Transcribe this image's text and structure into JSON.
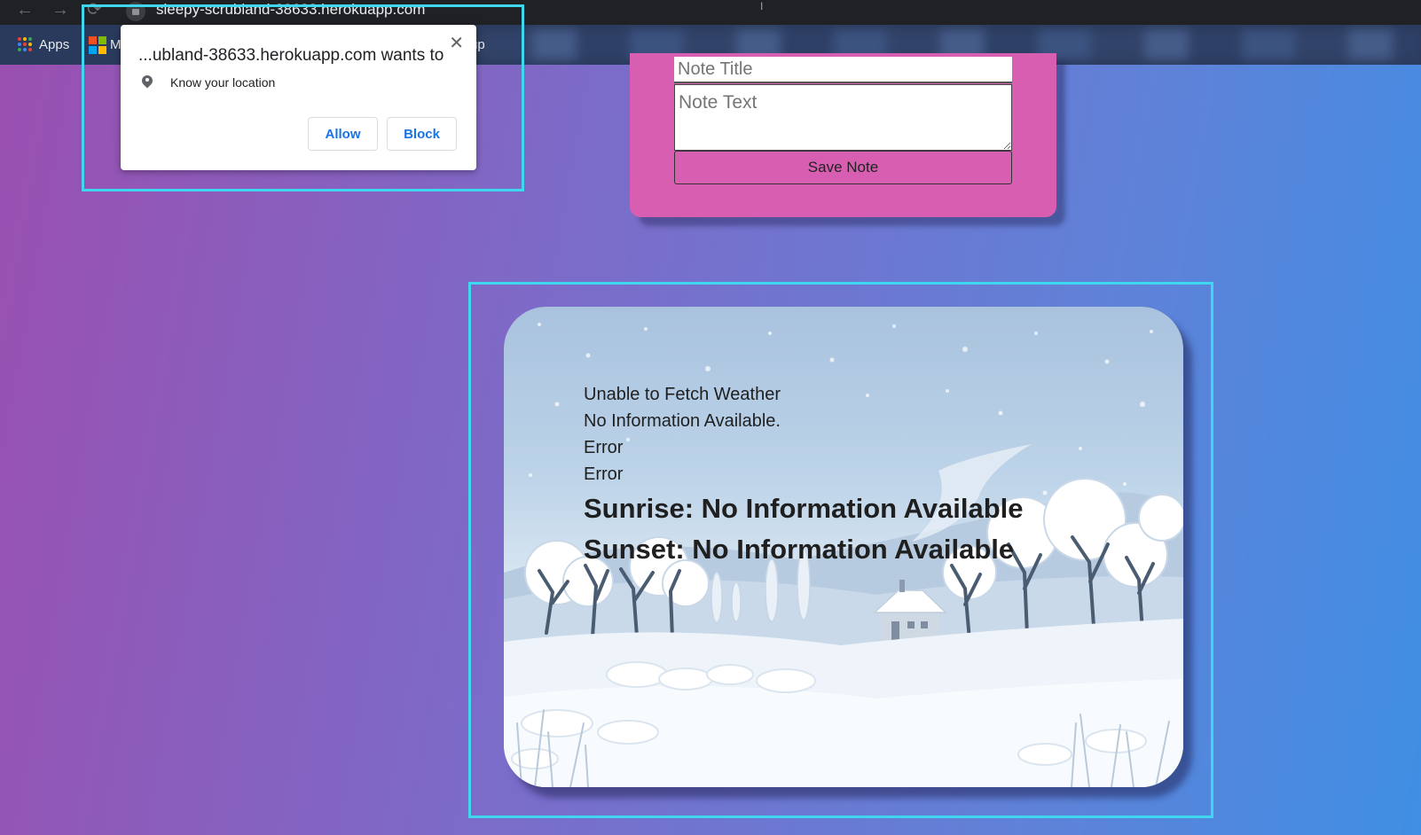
{
  "browser": {
    "url": "sleepy-scrubland-38633.herokuapp.com",
    "bookmarks": {
      "apps_label": "Apps",
      "m_label": "M",
      "tail_label": "up"
    }
  },
  "permission_popup": {
    "title": "...ubland-38633.herokuapp.com wants to",
    "permission": "Know your location",
    "close_glyph": "✕",
    "allow_label": "Allow",
    "block_label": "Block"
  },
  "note_form": {
    "title_placeholder": "Note Title",
    "text_placeholder": "Note Text",
    "save_label": "Save Note"
  },
  "weather": {
    "status": "Unable to Fetch Weather",
    "info": "No Information Available.",
    "error_1": "Error",
    "error_2": "Error",
    "sunrise": "Sunrise: No Information Available",
    "sunset": "Sunset: No Information Available"
  },
  "colors": {
    "highlight": "#3fd7f0",
    "note_card": "#d85eb2",
    "popup_button_text": "#1a73e8"
  }
}
